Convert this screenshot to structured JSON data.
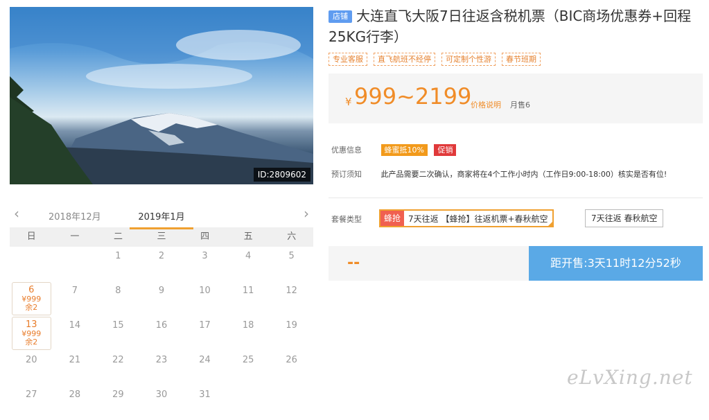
{
  "photo": {
    "id_label": "ID:2809602"
  },
  "calendar": {
    "prev_month": "2018年12月",
    "current_month": "2019年1月",
    "prev_arrow": "‹",
    "next_arrow": "›",
    "weekdays": [
      "日",
      "一",
      "二",
      "三",
      "四",
      "五",
      "六"
    ],
    "rows": [
      [
        {
          "d": ""
        },
        {
          "d": ""
        },
        {
          "d": "1"
        },
        {
          "d": "2"
        },
        {
          "d": "3"
        },
        {
          "d": "4"
        },
        {
          "d": "5"
        }
      ],
      [
        {
          "d": "6",
          "price": "¥999",
          "stock": "余2"
        },
        {
          "d": "7"
        },
        {
          "d": "8"
        },
        {
          "d": "9"
        },
        {
          "d": "10"
        },
        {
          "d": "11"
        },
        {
          "d": "12"
        }
      ],
      [
        {
          "d": "13",
          "price": "¥999",
          "stock": "余2"
        },
        {
          "d": "14"
        },
        {
          "d": "15"
        },
        {
          "d": "16"
        },
        {
          "d": "17"
        },
        {
          "d": "18"
        },
        {
          "d": "19"
        }
      ],
      [
        {
          "d": "20"
        },
        {
          "d": "21"
        },
        {
          "d": "22"
        },
        {
          "d": "23"
        },
        {
          "d": "24"
        },
        {
          "d": "25"
        },
        {
          "d": "26"
        }
      ],
      [
        {
          "d": "27"
        },
        {
          "d": "28"
        },
        {
          "d": "29"
        },
        {
          "d": "30"
        },
        {
          "d": "31"
        },
        {
          "d": ""
        },
        {
          "d": ""
        }
      ]
    ]
  },
  "product": {
    "store_badge": "店铺",
    "title": "大连直飞大阪7日往返含税机票（BIC商场优惠券+回程25KG行李）",
    "tags": [
      "专业客服",
      "直飞航班不经停",
      "可定制个性游",
      "春节班期"
    ]
  },
  "price": {
    "currency": "¥",
    "range": "999~2199",
    "note_link": "价格说明",
    "sales": "月售6"
  },
  "offers": {
    "label": "优惠信息",
    "coupon": "蜂蜜抵10%",
    "promo": "促销"
  },
  "notice": {
    "label": "预订须知",
    "text": "此产品需要二次确认，商家将在4个工作小时内（工作日9:00-18:00）核实是否有位!"
  },
  "package": {
    "label": "套餐类型",
    "option1_flash": "蜂抢",
    "option1_text": "7天往返 【蜂抢】往返机票+春秋航空",
    "option2_text": "7天往返 春秋航空"
  },
  "purchase": {
    "price_placeholder": "--",
    "countdown": "距开售:3天11时12分52秒"
  },
  "watermark": "eLvXing.net",
  "colors": {
    "accent": "#f08c28",
    "buy_button": "#5aa9e6",
    "badge": "#5f9cf0",
    "promo": "#e0393a"
  }
}
